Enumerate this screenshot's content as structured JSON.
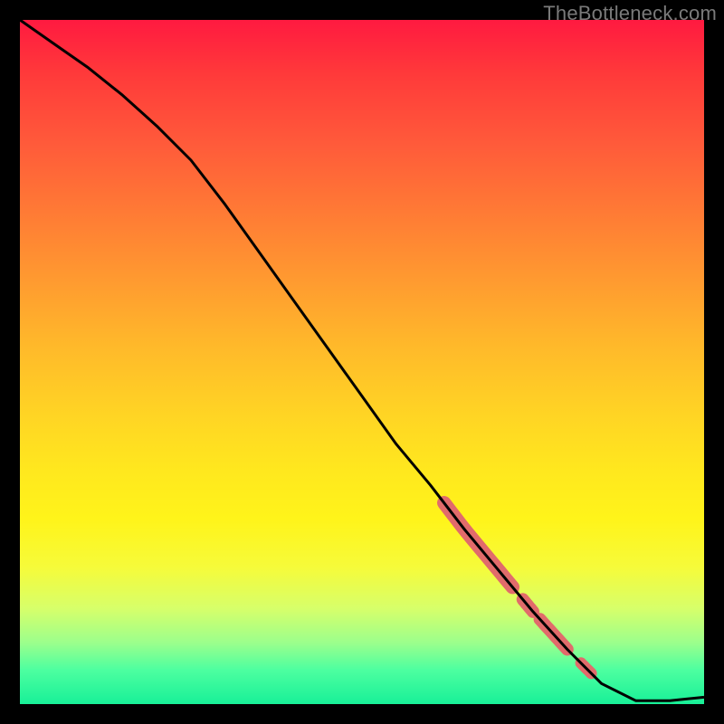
{
  "watermark": "TheBottleneck.com",
  "chart_data": {
    "type": "line",
    "title": "",
    "xlabel": "",
    "ylabel": "",
    "xlim": [
      0,
      100
    ],
    "ylim": [
      0,
      100
    ],
    "grid": false,
    "series": [
      {
        "name": "curve",
        "x": [
          0,
          5,
          10,
          15,
          20,
          25,
          30,
          35,
          40,
          45,
          50,
          55,
          60,
          65,
          70,
          75,
          80,
          85,
          90,
          95,
          100
        ],
        "y": [
          100,
          96.5,
          93,
          89,
          84.5,
          79.5,
          73,
          66,
          59,
          52,
          45,
          38,
          32,
          25.5,
          19.5,
          13.5,
          8,
          3,
          0.5,
          0.5,
          1
        ]
      }
    ],
    "highlights": [
      {
        "name": "segment-a",
        "x_start": 62,
        "x_end": 72,
        "width": 2.2
      },
      {
        "name": "segment-b",
        "x_start": 73.5,
        "x_end": 75,
        "width": 2.0
      },
      {
        "name": "segment-c",
        "x_start": 76,
        "x_end": 80,
        "width": 2.0
      },
      {
        "name": "segment-d",
        "x_start": 82,
        "x_end": 83.5,
        "width": 1.8
      }
    ],
    "colors": {
      "line": "#000000",
      "highlight": "#e16b6b",
      "background_top": "#ff1a40",
      "background_bottom": "#18f098"
    }
  }
}
